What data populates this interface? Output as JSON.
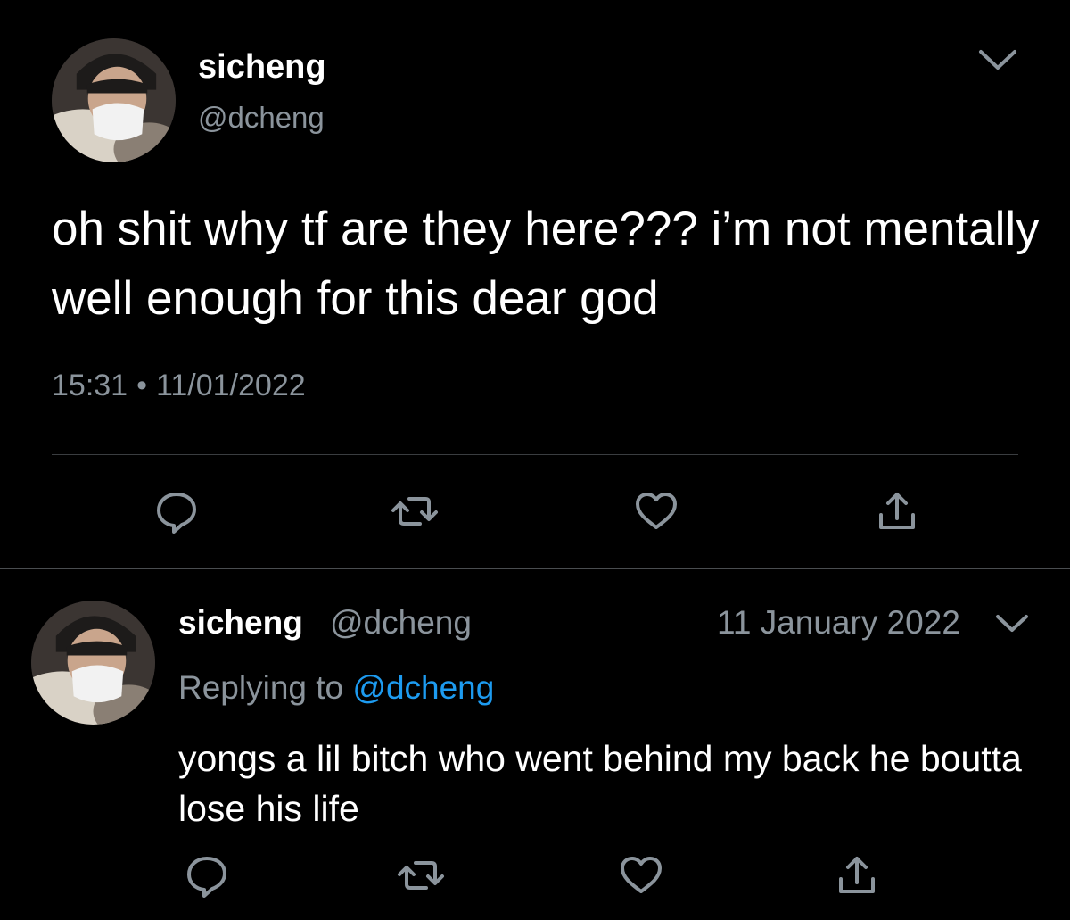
{
  "main_tweet": {
    "display_name": "sicheng",
    "handle": "@dcheng",
    "text": "oh shit why tf are they here??? i’m not mentally well enough for this dear god",
    "time": "15:31",
    "separator": "•",
    "date": "11/01/2022",
    "actions": [
      "reply-icon",
      "retweet-icon",
      "like-icon",
      "share-icon"
    ]
  },
  "reply_tweet": {
    "display_name": "sicheng",
    "handle": "@dcheng",
    "date": "11 January 2022",
    "replying_prefix": "Replying to",
    "replying_handle": "@dcheng",
    "text": "yongs a lil bitch who went behind my back he boutta lose his life",
    "actions": [
      "reply-icon",
      "retweet-icon",
      "like-icon",
      "share-icon"
    ]
  },
  "colors": {
    "background": "#000000",
    "primary_text": "#ffffff",
    "secondary_text": "#8b949c",
    "link": "#1d9bf0",
    "divider": "#3a3d40"
  }
}
